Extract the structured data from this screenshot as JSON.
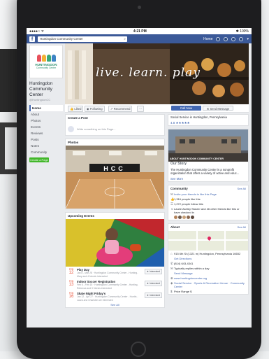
{
  "statusbar": {
    "carrier": "●●●●○ ᯤ",
    "time": "4:21 PM",
    "battery": "✱ 100%"
  },
  "fbbar": {
    "search_value": "Huntingdon Community Center",
    "home": "Home"
  },
  "page": {
    "logo_line1": "HUNTINGDON",
    "logo_line2": "Community Center",
    "name": "Huntingdon Community Center",
    "handle": "@HuntingdonCC",
    "nav": [
      "Home",
      "About",
      "Photos",
      "Events",
      "Reviews",
      "Posts",
      "Notes",
      "Community"
    ],
    "create_page": "Create a Page",
    "cover_tagline": "live. learn. play"
  },
  "actions": {
    "liked": "Liked",
    "following": "Following",
    "recommend": "Recommend",
    "more": "···",
    "call_now": "Call Now",
    "send_message": "Send Message"
  },
  "create_post": {
    "title": "Create a Post",
    "placeholder": "Write something on this Page..."
  },
  "photos": {
    "title": "Photos",
    "court_letters": "HCC"
  },
  "events": {
    "title": "Upcoming Events",
    "items": [
      {
        "month": "FEB",
        "day": "12",
        "title": "Play Day",
        "sub1": "Jan 8 - Mar 28 · Huntingdon Community Center - Hunting...",
        "sub2": "Mary and 4 friends interested",
        "btn": "Interested"
      },
      {
        "month": "FEB",
        "day": "13",
        "title": "Indoor Soccer Registration",
        "sub1": "Feb 6 - Feb 15 · Huntingdon Community Center - Hunting...",
        "sub2": "Rebecca and 3 friends interested",
        "btn": "Interested"
      },
      {
        "month": "FEB",
        "day": "16",
        "title": "Skate Night Friday's",
        "sub1": "Jan 12 - Apr 27 · Huntingdon Community Center - Huntin...",
        "sub2": "Laura and Charlotte are interested",
        "btn": "Interested"
      }
    ],
    "see_all": "See All"
  },
  "right": {
    "category": "Social Service in Huntingdon, Pennsylvania",
    "stars": "4.8 ★★★★★",
    "story_image_label": "ABOUT HUNTINGDON COMMUNITY CENTER",
    "story_title": "Our Story",
    "story_text": "The Huntingdon Community Center is a nonprofit organization that offers a variety of active and educ...",
    "see_more": "See More",
    "community_title": "Community",
    "see_all": "See All",
    "community_rows": [
      {
        "icon": "✉",
        "text": "Invite your friends to like this Page"
      },
      {
        "icon": "👍",
        "text": "1,316 people like this"
      },
      {
        "icon": "☰",
        "text": "1,272 people follow this"
      },
      {
        "icon": "☺",
        "text": "Laurie Ashley Stutzer and 46 other friends like this or have checked in"
      }
    ],
    "about_title": "About",
    "about_rows": [
      {
        "icon": "⌂",
        "text": "915 6th St (1321 m) Huntingdon, Pennsylvania 16652"
      },
      {
        "icon": "",
        "text": "Get Directions"
      },
      {
        "icon": "✆",
        "text": "(814) 643-4341"
      },
      {
        "icon": "✉",
        "text": "Typically replies within a day"
      },
      {
        "icon": "",
        "text": "Send Message"
      },
      {
        "icon": "⊕",
        "text": "www.huntingdoncenter.org"
      },
      {
        "icon": "◈",
        "text": "Social Service · Sports & Recreation Venue · Community Center"
      },
      {
        "icon": "$",
        "text": "Price Range $"
      }
    ]
  },
  "colors": {
    "fb_blue": "#3b5998",
    "button_blue": "#4267b2",
    "create_green": "#42b72a",
    "event_red": "#e9573f"
  }
}
